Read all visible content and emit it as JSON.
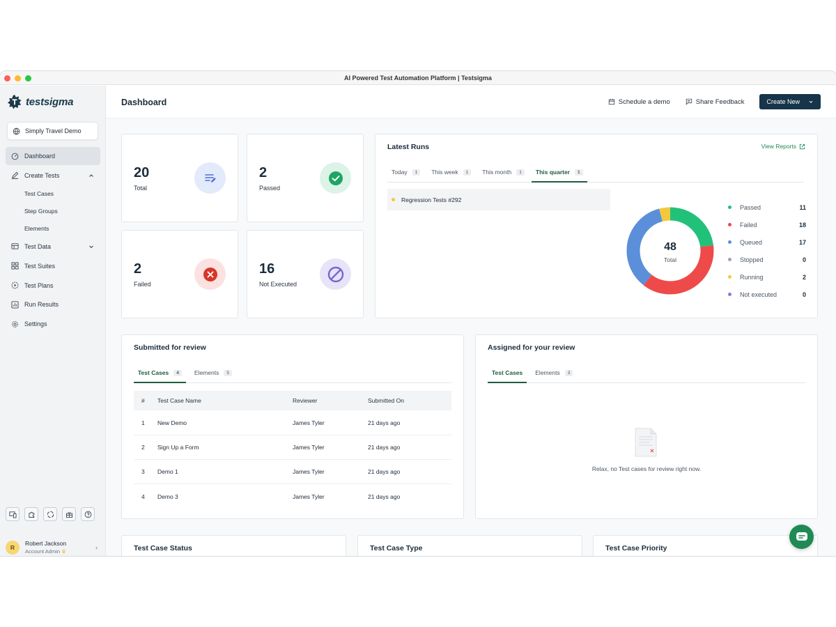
{
  "window": {
    "title": "AI Powered Test Automation Platform | Testsigma"
  },
  "brand": {
    "name": "testsigma"
  },
  "project": {
    "name": "Simply Travel Demo"
  },
  "sidebar": {
    "items": [
      {
        "label": "Dashboard",
        "icon": "dashboard-icon"
      },
      {
        "label": "Create Tests",
        "icon": "pen-icon"
      },
      {
        "label": "Test Cases"
      },
      {
        "label": "Step Groups"
      },
      {
        "label": "Elements"
      },
      {
        "label": "Test Data",
        "icon": "table-icon"
      },
      {
        "label": "Test Suites",
        "icon": "grid-icon"
      },
      {
        "label": "Test Plans",
        "icon": "play-circle-icon"
      },
      {
        "label": "Run Results",
        "icon": "chart-icon"
      },
      {
        "label": "Settings",
        "icon": "gear-icon"
      }
    ],
    "bottom_icons": [
      "devices-icon",
      "puzzle-icon",
      "circle-dash-icon",
      "gift-icon",
      "help-icon"
    ]
  },
  "user": {
    "initial": "R",
    "name": "Robert Jackson",
    "role": "Account Admin"
  },
  "header": {
    "title": "Dashboard",
    "schedule_demo": "Schedule a demo",
    "share_feedback": "Share Feedback",
    "create_new": "Create New"
  },
  "stats": {
    "total": {
      "value": "20",
      "label": "Total"
    },
    "passed": {
      "value": "2",
      "label": "Passed"
    },
    "failed": {
      "value": "2",
      "label": "Failed"
    },
    "not_executed": {
      "value": "16",
      "label": "Not Executed"
    }
  },
  "latest_runs": {
    "title": "Latest Runs",
    "view_reports": "View Reports",
    "tabs": [
      {
        "label": "Today",
        "count": "1"
      },
      {
        "label": "This week",
        "count": "1"
      },
      {
        "label": "This month",
        "count": "1"
      },
      {
        "label": "This quarter",
        "count": "1"
      }
    ],
    "active_tab": "This quarter",
    "runs": [
      {
        "name": "Regression Tests #292"
      }
    ],
    "donut_total": "48",
    "donut_total_label": "Total"
  },
  "chart_data": {
    "type": "pie",
    "categories": [
      "Passed",
      "Failed",
      "Queued",
      "Stopped",
      "Running",
      "Not executed"
    ],
    "values": [
      11,
      18,
      17,
      0,
      2,
      0
    ],
    "colors": [
      "#22c17a",
      "#ee4a4a",
      "#5b8fd9",
      "#9aa6b8",
      "#f3c93b",
      "#8c79d8"
    ],
    "center_value": "48",
    "center_label": "Total"
  },
  "submitted": {
    "title": "Submitted for review",
    "tabs": [
      {
        "label": "Test Cases",
        "count": "4"
      },
      {
        "label": "Elements",
        "count": "5"
      }
    ],
    "columns": [
      "#",
      "Test Case Name",
      "Reviewer",
      "Submitted On"
    ],
    "rows": [
      [
        "1",
        "New Demo",
        "James Tyler",
        "21 days ago"
      ],
      [
        "2",
        "Sign Up a Form",
        "James Tyler",
        "21 days ago"
      ],
      [
        "3",
        "Demo 1",
        "James Tyler",
        "21 days ago"
      ],
      [
        "4",
        "Demo 3",
        "James Tyler",
        "21 days ago"
      ]
    ]
  },
  "assigned": {
    "title": "Assigned for your review",
    "tabs": [
      {
        "label": "Test Cases",
        "count": ""
      },
      {
        "label": "Elements",
        "count": "3"
      }
    ],
    "empty_text": "Relax, no Test cases for review right now."
  },
  "bottom_cards": {
    "status": "Test Case Status",
    "type": "Test Case Type",
    "priority": "Test Case Priority"
  }
}
